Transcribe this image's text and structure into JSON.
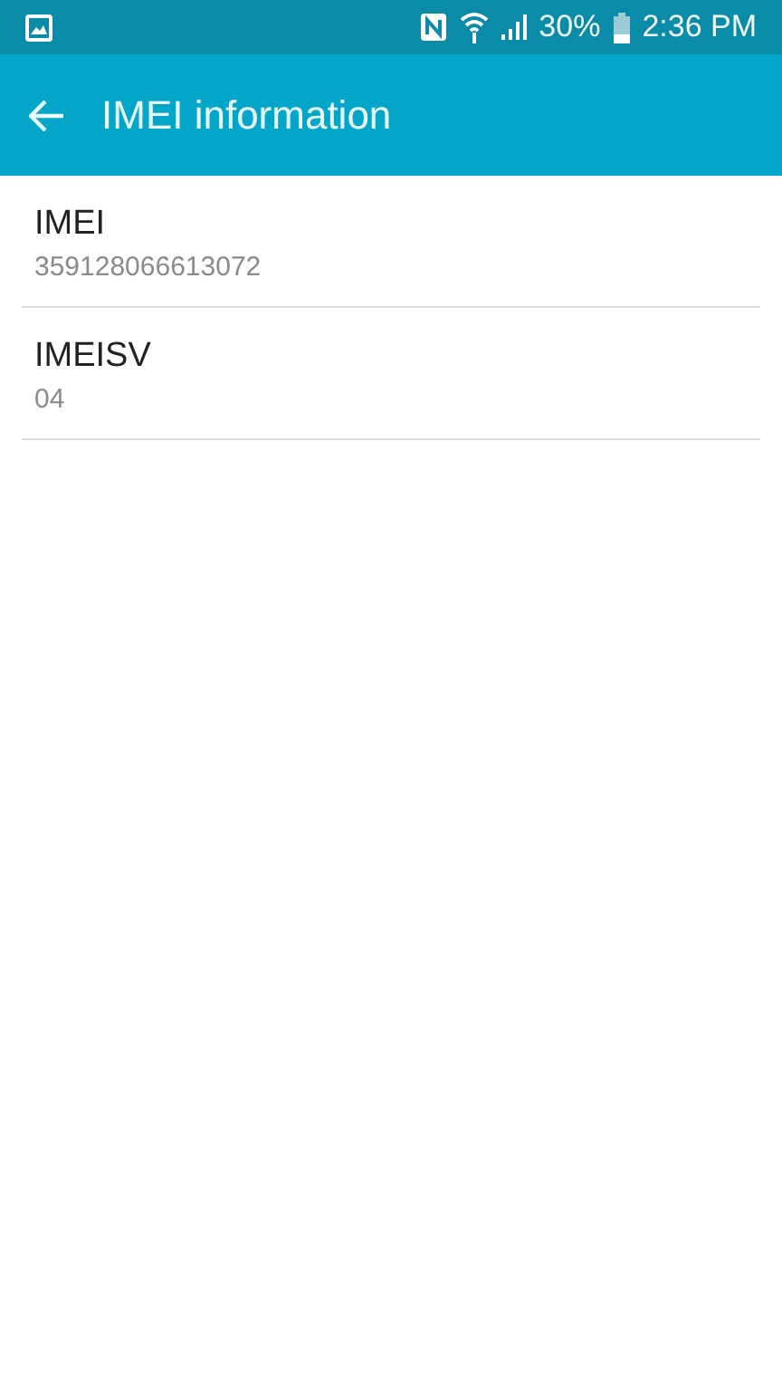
{
  "status_bar": {
    "battery": "30%",
    "time": "2:36 PM"
  },
  "app_bar": {
    "title": "IMEI information"
  },
  "items": [
    {
      "title": "IMEI",
      "value": "359128066613072"
    },
    {
      "title": "IMEISV",
      "value": "04"
    }
  ]
}
